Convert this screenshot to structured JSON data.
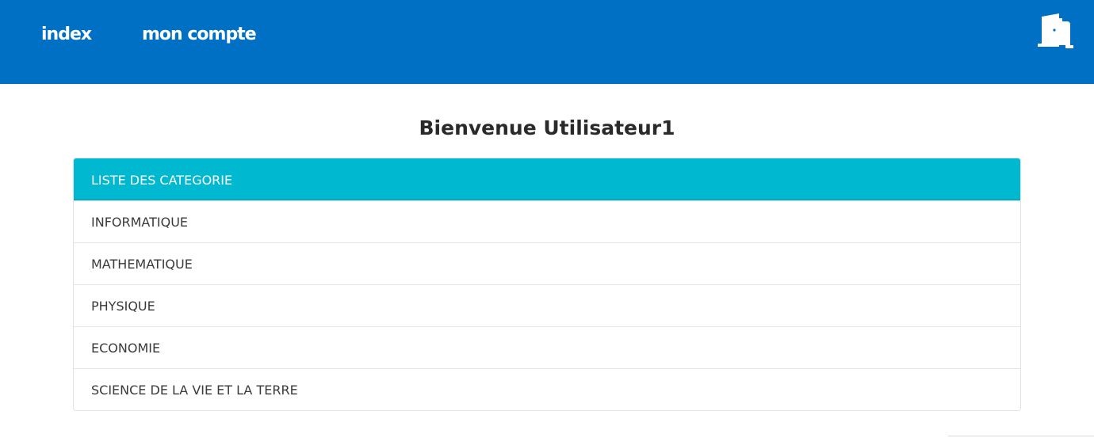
{
  "nav": {
    "index_label": "index",
    "account_label": "mon compte",
    "logout_icon": "door-exit-icon"
  },
  "welcome": "Bienvenue Utilisateur1",
  "categories": {
    "header": "LISTE DES CATEGORIE",
    "items": [
      {
        "label": "INFORMATIQUE"
      },
      {
        "label": "MATHEMATIQUE"
      },
      {
        "label": "PHYSIQUE"
      },
      {
        "label": "ECONOMIE"
      },
      {
        "label": "SCIENCE DE LA VIE ET LA TERRE"
      }
    ]
  },
  "colors": {
    "navbar": "#0070c4",
    "list_header": "#00b8cf"
  }
}
